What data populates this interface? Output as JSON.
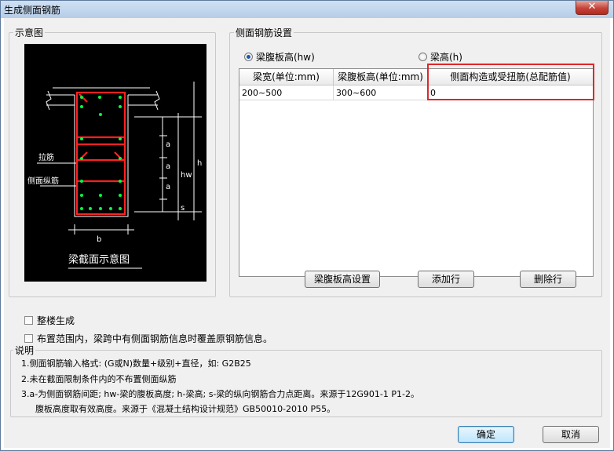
{
  "window": {
    "title": "生成侧面钢筋",
    "close_glyph": "✕"
  },
  "diagram_group": {
    "label": "示意图",
    "caption": "梁截面示意图",
    "labels": {
      "tie": "拉筋",
      "side_bar": "侧面纵筋",
      "b": "b",
      "a1": "a",
      "a2": "a",
      "a3": "a",
      "s": "s",
      "hw": "hw",
      "h": "h"
    }
  },
  "settings_group": {
    "label": "侧面钢筋设置",
    "radio_web_height": {
      "label": "梁腹板高(hw)",
      "selected": true
    },
    "radio_beam_height": {
      "label": "梁高(h)",
      "selected": false
    },
    "table": {
      "headers": [
        "梁宽(单位:mm)",
        "梁腹板高(单位:mm)",
        "侧面构造或受扭筋(总配筋值)"
      ],
      "rows": [
        [
          "200~500",
          "300~600",
          "0"
        ]
      ]
    },
    "buttons": {
      "web_height_settings": "梁腹板高设置",
      "add_row": "添加行",
      "delete_row": "删除行"
    }
  },
  "options": {
    "whole_building": {
      "label": "整楼生成",
      "checked": false
    },
    "overwrite": {
      "label": "布置范围内，梁跨中有侧面钢筋信息时覆盖原钢筋信息。",
      "checked": false
    }
  },
  "notes": {
    "title": "说明",
    "lines": [
      "1.侧面钢筋输入格式: (G或N)数量+级别+直径，如: G2B25",
      "2.未在截面限制条件内的不布置侧面纵筋",
      "3.a-为侧面钢筋间距; hw-梁的腹板高度; h-梁高; s-梁的纵向钢筋合力点距离。来源于12G901-1 P1-2。",
      "腹板高度取有效高度。来源于《混凝土结构设计规范》GB50010-2010 P55。"
    ]
  },
  "footer": {
    "ok": "确定",
    "cancel": "取消"
  },
  "colors": {
    "accent_red": "#e0262a",
    "rebar_red": "#ff2020",
    "bar_dot_green": "#00ff40"
  }
}
